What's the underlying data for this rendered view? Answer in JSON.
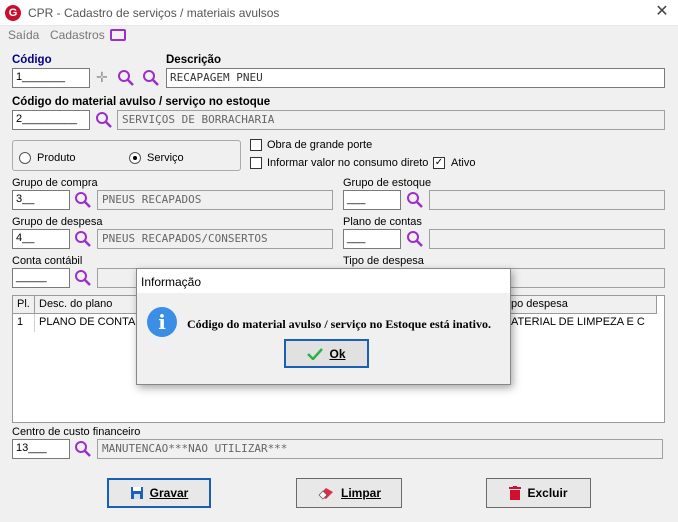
{
  "window": {
    "title": "CPR - Cadastro de serviços / materiais avulsos",
    "close": "✕"
  },
  "menu": {
    "saida": "Saída",
    "cadastros": "Cadastros"
  },
  "codigo": {
    "label": "Código",
    "value": "1_______"
  },
  "descricao": {
    "label": "Descrição",
    "value": "RECAPAGEM PNEU"
  },
  "material": {
    "label": "Código do material avulso / serviço no estoque",
    "code": "2_________",
    "desc": "SERVIÇOS DE BORRACHARIA"
  },
  "tipo": {
    "produto": "Produto",
    "servico": "Serviço",
    "selected": "servico"
  },
  "options": {
    "obra": "Obra de grande porte",
    "informar": "Informar valor no consumo direto",
    "ativo": "Ativo"
  },
  "grupo_compra": {
    "label": "Grupo de compra",
    "code": "3__",
    "desc": "PNEUS RECAPADOS"
  },
  "grupo_estoque": {
    "label": "Grupo de estoque",
    "code": "___",
    "desc": ""
  },
  "grupo_despesa": {
    "label": "Grupo de despesa",
    "code": "4__",
    "desc": "PNEUS RECAPADOS/CONSERTOS"
  },
  "plano_contas": {
    "label": "Plano de contas",
    "code": "___",
    "desc": ""
  },
  "conta_contabil": {
    "label": "Conta contábil",
    "code": "_____",
    "desc": ""
  },
  "tipo_despesa": {
    "label": "Tipo de despesa"
  },
  "grid": {
    "headers": {
      "pl": "Pl.",
      "desc": "Desc. do plano",
      "tipo": "po despesa"
    },
    "rows": [
      {
        "pl": "1",
        "desc": "PLANO DE CONTAS",
        "tipo": "ATERIAL DE LIMPEZA E C"
      }
    ]
  },
  "centro_custo": {
    "label": "Centro de custo financeiro",
    "code": "13___",
    "desc": "MANUTENCAO***NAO UTILIZAR***"
  },
  "buttons": {
    "gravar": "Gravar",
    "limpar": "Limpar",
    "excluir": "Excluir"
  },
  "dialog": {
    "title": "Informação",
    "message": "Código do material avulso / serviço no Estoque está inativo.",
    "ok": "Ok"
  }
}
